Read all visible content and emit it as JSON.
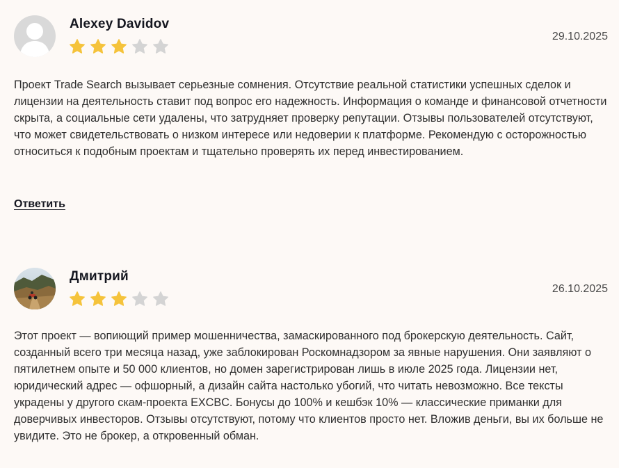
{
  "colors": {
    "star_filled": "#f5c33b",
    "star_empty": "#d4d4d4",
    "background": "#fdf9f6"
  },
  "reviews": [
    {
      "author": "Alexey Davidov",
      "date": "29.10.2025",
      "rating": 3,
      "max_rating": 5,
      "avatar": "default-user-icon",
      "text": "Проект Trade Search вызывает серьезные сомнения. Отсутствие реальной статистики успешных сделок и лицензии на деятельность ставит под вопрос его надежность. Информация о команде и финансовой отчетности скрыта, а социальные сети удалены, что затрудняет проверку репутации. Отзывы пользователей отсутствуют, что может свидетельствовать о низком интересе или недоверии к платформе. Рекомендую с осторожностью относиться к подобным проектам и тщательно проверять их перед инвестированием.",
      "reply_label": "Ответить"
    },
    {
      "author": "Дмитрий",
      "date": "26.10.2025",
      "rating": 3,
      "max_rating": 5,
      "avatar": "photo-avatar",
      "text": "Этот проект — вопиющий пример мошенничества, замаскированного под брокерскую деятельность. Сайт, созданный всего три месяца назад, уже заблокирован Роскомнадзором за явные нарушения. Они заявляют о пятилетнем опыте и 50 000 клиентов, но домен зарегистрирован лишь в июле 2025 года. Лицензии нет, юридический адрес — офшорный, а дизайн сайта настолько убогий, что читать невозможно. Все тексты украдены у другого скам-проекта EXCBC. Бонусы до 100% и кешбэк 10% — классические приманки для доверчивых инвесторов. Отзывы отсутствуют, потому что клиентов просто нет. Вложив деньги, вы их больше не увидите. Это не брокер, а откровенный обман."
    }
  ]
}
